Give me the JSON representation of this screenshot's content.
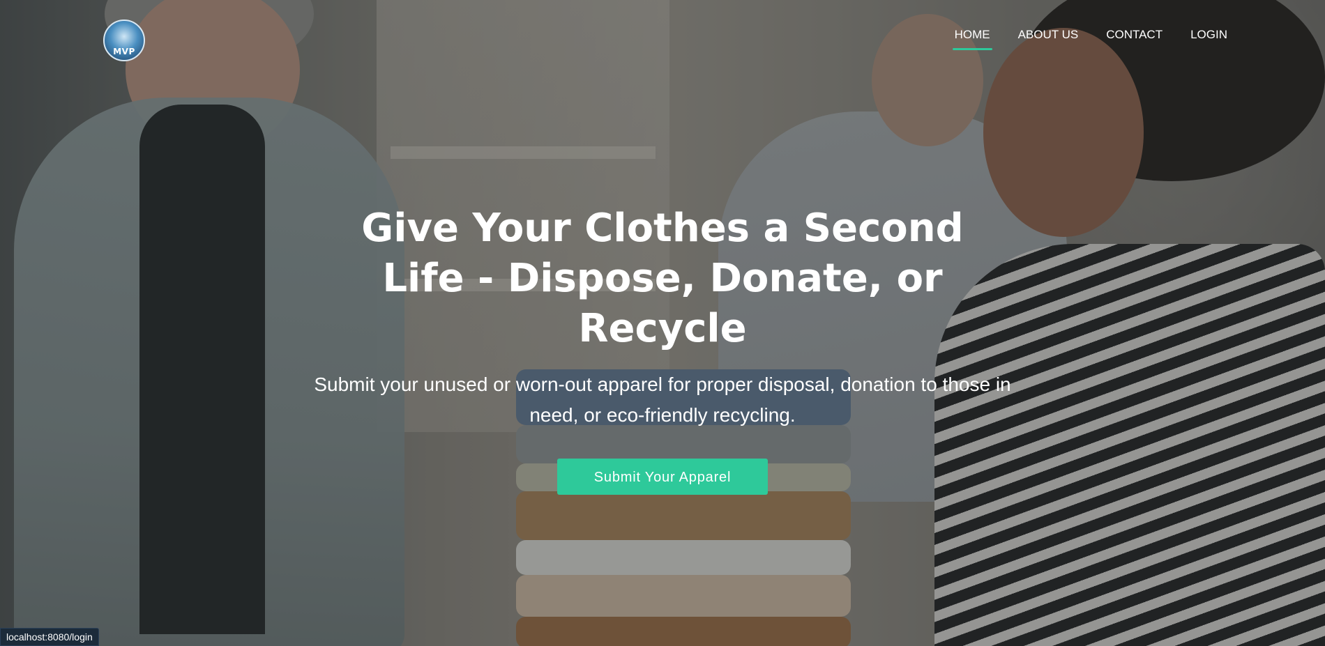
{
  "header": {
    "logo_text": "MVP",
    "nav": [
      {
        "label": "HOME",
        "active": true
      },
      {
        "label": "ABOUT US",
        "active": false
      },
      {
        "label": "CONTACT",
        "active": false
      },
      {
        "label": "LOGIN",
        "active": false
      }
    ]
  },
  "hero": {
    "title": "Give Your Clothes a Second Life - Dispose, Donate, or Recycle",
    "subtitle": "Submit your unused or worn-out apparel for proper disposal, donation to those in need, or eco-friendly recycling.",
    "cta_label": "Submit Your Apparel"
  },
  "status_bar": {
    "url": "localhost:8080/login"
  },
  "colors": {
    "accent": "#2ec99a",
    "text": "#ffffff",
    "status_bg": "#1c2b3a"
  }
}
